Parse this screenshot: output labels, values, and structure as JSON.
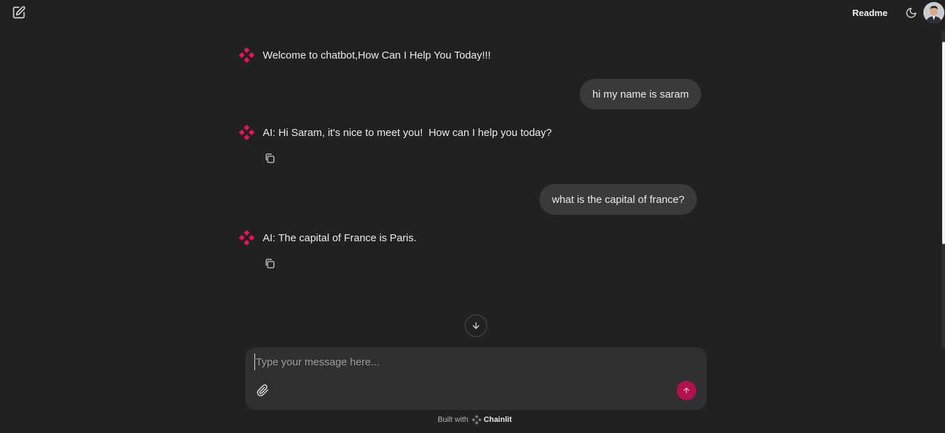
{
  "header": {
    "new_chat_icon": "edit-icon",
    "readme_label": "Readme",
    "theme_icon": "moon-icon",
    "avatar_icon": "user-avatar"
  },
  "messages": [
    {
      "role": "assistant",
      "text": "Welcome to chatbot,How Can I Help You Today!!!",
      "copy": false
    },
    {
      "role": "user",
      "text": "hi my name is saram"
    },
    {
      "role": "assistant",
      "text": "AI: Hi Saram, it's nice to meet you!  How can I help you today?",
      "copy": true
    },
    {
      "role": "user",
      "text": "what is the capital of france?"
    },
    {
      "role": "assistant",
      "text": "AI: The capital of France is Paris.",
      "copy": true
    }
  ],
  "composer": {
    "placeholder": "Type your message here...",
    "value": "",
    "attach_icon": "paperclip-icon",
    "send_icon": "arrow-up-icon"
  },
  "footer": {
    "built_with": "Built with",
    "brand": "Chainlit"
  },
  "colors": {
    "background": "#212121",
    "accent": "#e8125c",
    "send_button": "#b0124f",
    "user_bubble": "#3a3a3a",
    "composer": "#303030"
  }
}
